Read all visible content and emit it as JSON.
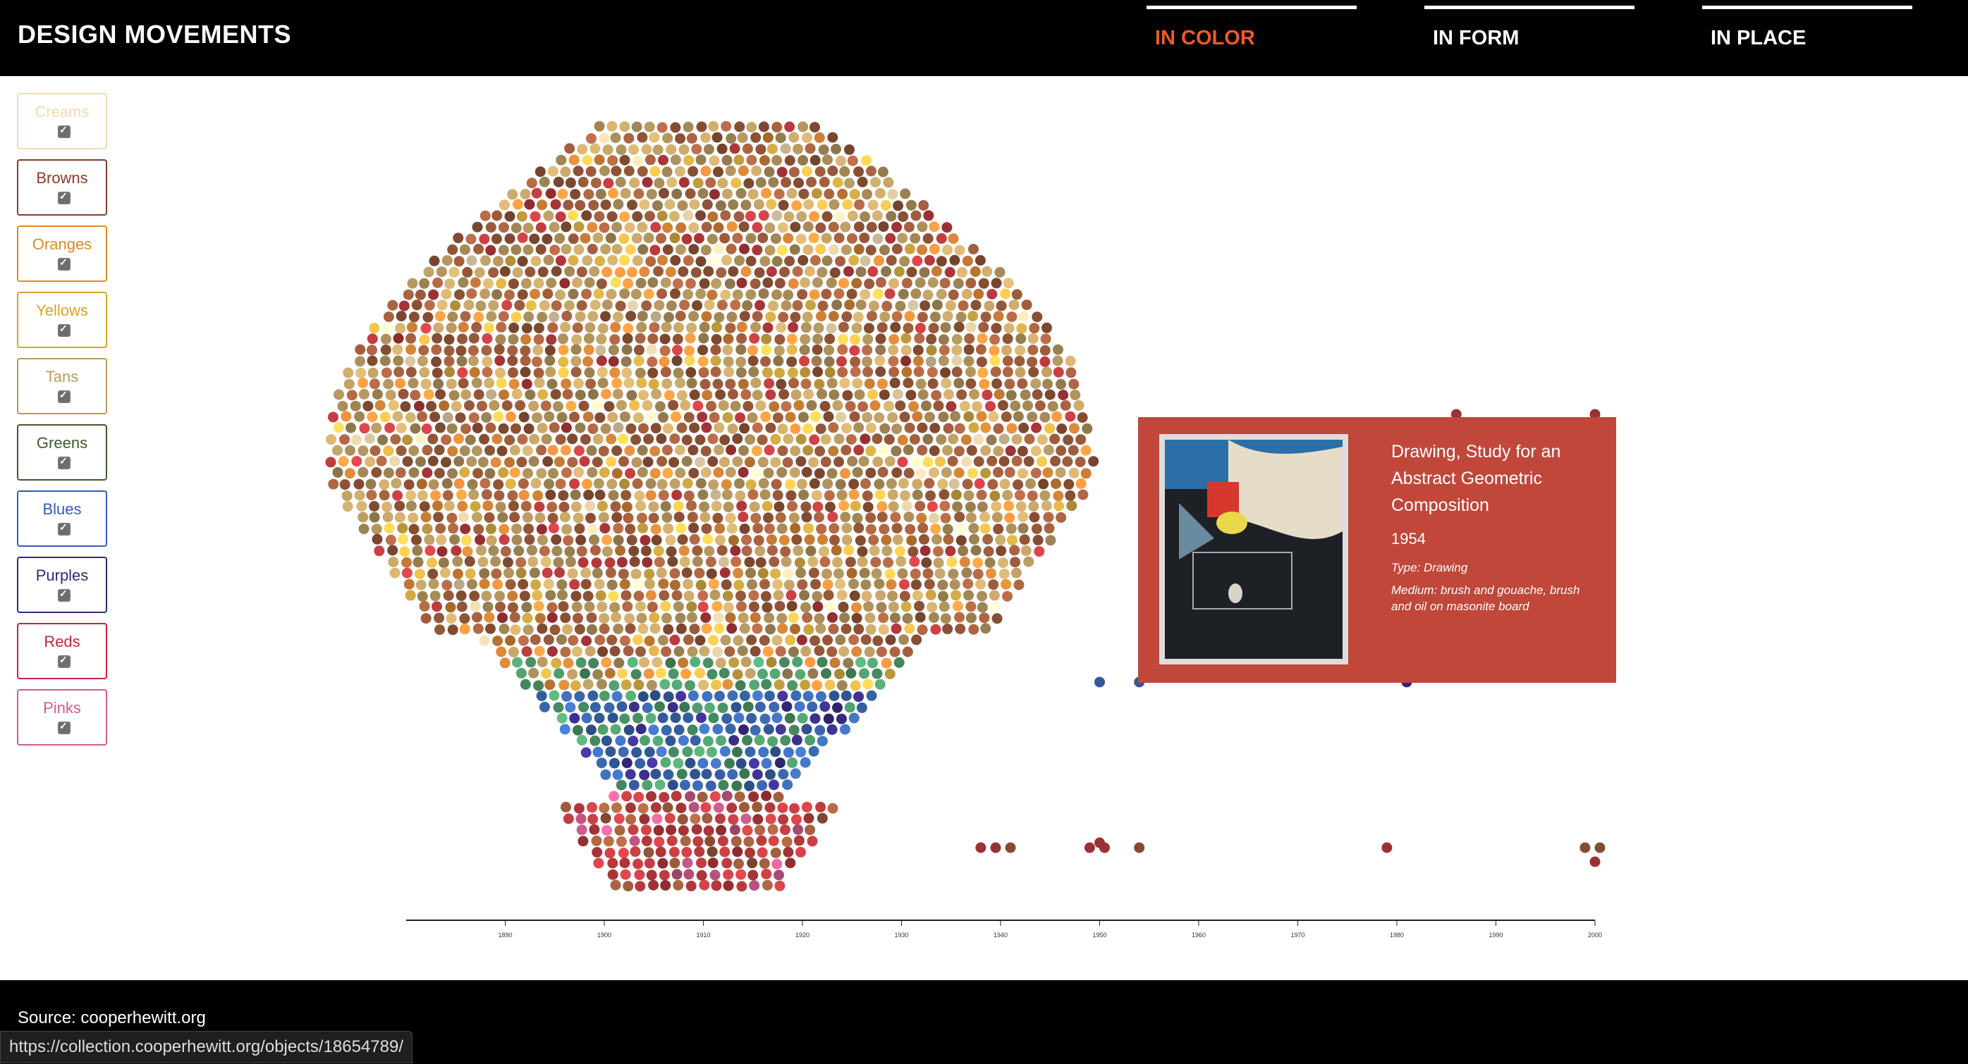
{
  "header": {
    "title": "DESIGN MOVEMENTS",
    "accent_color": "#f05a28",
    "nav": [
      {
        "label": "IN COLOR",
        "active": true
      },
      {
        "label": "IN FORM",
        "active": false
      },
      {
        "label": "IN PLACE",
        "active": false
      }
    ]
  },
  "filters": [
    {
      "label": "Creams",
      "color": "#f0dcb0",
      "checked": true
    },
    {
      "label": "Browns",
      "color": "#8b3a2a",
      "checked": true
    },
    {
      "label": "Oranges",
      "color": "#e08a20",
      "checked": true
    },
    {
      "label": "Yellows",
      "color": "#d9a520",
      "checked": true
    },
    {
      "label": "Tans",
      "color": "#b79c5c",
      "checked": true
    },
    {
      "label": "Greens",
      "color": "#3f5a2a",
      "checked": true
    },
    {
      "label": "Blues",
      "color": "#3358c4",
      "checked": true
    },
    {
      "label": "Purples",
      "color": "#2d2a7a",
      "checked": true
    },
    {
      "label": "Reds",
      "color": "#c8243a",
      "checked": true
    },
    {
      "label": "Pinks",
      "color": "#d45a8a",
      "checked": true
    }
  ],
  "chart_data": {
    "type": "scatter",
    "description": "beeswarm",
    "xlim": [
      1880,
      2000
    ],
    "ticks": [
      1890,
      1900,
      1910,
      1920,
      1930,
      1940,
      1950,
      1960,
      1970,
      1980,
      1990,
      2000
    ],
    "tick_labels": [
      "1890",
      "1900",
      "1910",
      "1920",
      "1930",
      "1940",
      "1950",
      "1960",
      "1970",
      "1980",
      "1990",
      "2000"
    ],
    "groups": [
      {
        "name": "Creams",
        "color": "#ead7ae",
        "count": 70
      },
      {
        "name": "Browns",
        "color": "#9a5a3c",
        "count": 720
      },
      {
        "name": "Oranges",
        "color": "#dd8a3a",
        "count": 180
      },
      {
        "name": "Yellows",
        "color": "#e0b548",
        "count": 140
      },
      {
        "name": "Tans",
        "color": "#b89a62",
        "count": 780
      },
      {
        "name": "Greens",
        "color": "#4e9a6a",
        "count": 45
      },
      {
        "name": "Blues",
        "color": "#3b68b0",
        "count": 110
      },
      {
        "name": "Purples",
        "color": "#3a2f8a",
        "count": 45
      },
      {
        "name": "Reds",
        "color": "#b83a3e",
        "count": 120
      },
      {
        "name": "Pinks",
        "color": "#c95a8a",
        "count": 25
      }
    ],
    "outliers": [
      {
        "x": 1938,
        "group": "Reds"
      },
      {
        "x": 1939.5,
        "group": "Reds"
      },
      {
        "x": 1941,
        "group": "Browns"
      },
      {
        "x": 1949,
        "group": "Reds"
      },
      {
        "x": 1950,
        "group": "Reds"
      },
      {
        "x": 1950.5,
        "group": "Reds"
      },
      {
        "x": 1954,
        "group": "Browns"
      },
      {
        "x": 1979,
        "group": "Reds"
      },
      {
        "x": 1999,
        "group": "Browns"
      },
      {
        "x": 2000,
        "group": "Reds"
      },
      {
        "x": 2000.5,
        "group": "Browns"
      },
      {
        "x": 1950,
        "group": "Blues"
      },
      {
        "x": 1954,
        "group": "Blues"
      },
      {
        "x": 1981,
        "group": "Purples"
      },
      {
        "x": 1986,
        "group": "Reds"
      },
      {
        "x": 2000,
        "group": "Reds"
      }
    ]
  },
  "tooltip": {
    "title": "Drawing, Study for an Abstract Geometric Composition",
    "date": "1954",
    "type": "Type: Drawing",
    "medium": "Medium: brush and gouache, brush and oil on masonite board",
    "background": "#c0473a"
  },
  "footer": {
    "source": "Source: cooperhewitt.org",
    "status_url": "https://collection.cooperhewitt.org/objects/18654789/"
  }
}
